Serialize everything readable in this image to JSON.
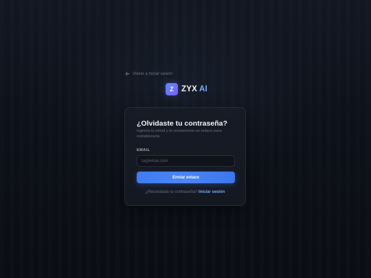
{
  "back_link": {
    "label": "Volver a iniciar sesión",
    "icon": "arrow-left-icon"
  },
  "brand": {
    "logo_letter": "Z",
    "name": "ZYX",
    "accent": "AI"
  },
  "card": {
    "title": "¿Olvidaste tu contraseña?",
    "subtitle": "Ingresa tu email y te enviaremos un enlace para restablecerla",
    "email_label": "EMAIL",
    "email_placeholder": "tu@email.com",
    "email_value": "",
    "submit_label": "Enviar enlace",
    "footer_text": "¿Recordaste tu contraseña?",
    "footer_link": "Iniciar sesión"
  },
  "colors": {
    "background": "#0b0e14",
    "card": "#161a23",
    "primary": "#3f7cf0",
    "link": "#7eaaf7",
    "logo_gradient_start": "#5b8cff",
    "logo_gradient_end": "#7a5cf0"
  }
}
